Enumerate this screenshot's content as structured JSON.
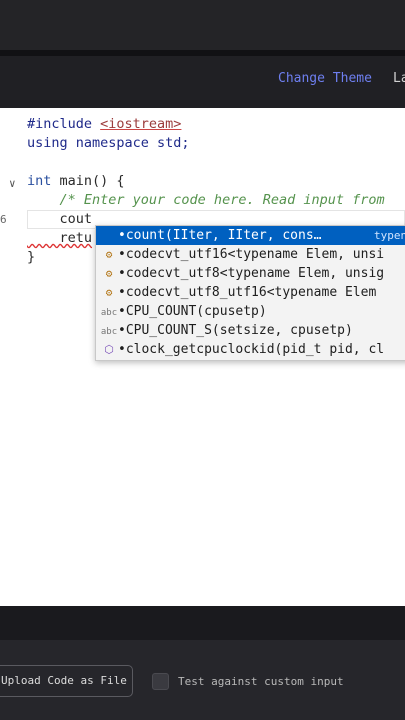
{
  "header": {
    "change_theme": "Change Theme",
    "language_cut": "La"
  },
  "gutter": {
    "line6_number": "6"
  },
  "code": {
    "line1_kw": "#include ",
    "line1_inc": "<iostream>",
    "line2": "using namespace std;",
    "line4_type": "int",
    "line4_rest": " main() {",
    "line5": "    /* Enter your code here. Read input from",
    "line6": "    cout",
    "line7": "    retu",
    "line8": "}"
  },
  "autocomplete": {
    "items": [
      {
        "label": "•count(IIter, IIter, cons…",
        "detail": "typena",
        "icon": "method-icon"
      },
      {
        "label": "•codecvt_utf16<typename Elem, unsi",
        "icon": "class-icon"
      },
      {
        "label": "•codecvt_utf8<typename Elem, unsig",
        "icon": "class-icon"
      },
      {
        "label": "•codecvt_utf8_utf16<typename Elem",
        "icon": "class-icon"
      },
      {
        "label": "•CPU_COUNT(cpusetp)",
        "icon": "text-icon"
      },
      {
        "label": "•CPU_COUNT_S(setsize, cpusetp)",
        "icon": "text-icon"
      },
      {
        "label": "•clock_getcpuclockid(pid_t pid, cl",
        "icon": "cube-icon"
      }
    ]
  },
  "footer": {
    "upload_label": "Upload Code as File",
    "test_label": "Test against custom input"
  },
  "colors": {
    "accent": "#6e7ff0",
    "selection": "#0060c0"
  }
}
